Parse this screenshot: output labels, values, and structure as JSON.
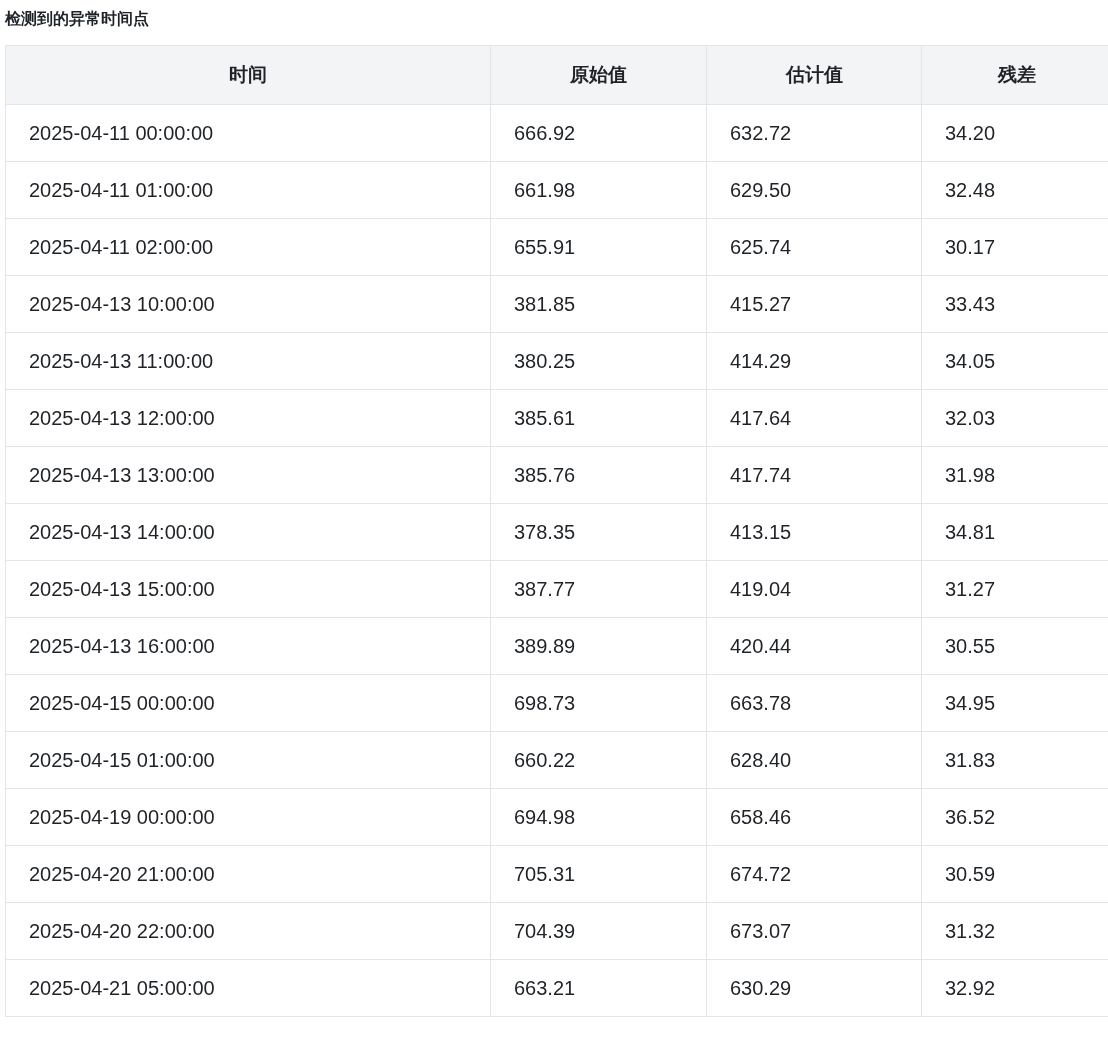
{
  "title": "检测到的异常时间点",
  "table": {
    "columns": [
      "时间",
      "原始值",
      "估计值",
      "残差"
    ],
    "rows": [
      [
        "2025-04-11 00:00:00",
        "666.92",
        "632.72",
        "34.20"
      ],
      [
        "2025-04-11 01:00:00",
        "661.98",
        "629.50",
        "32.48"
      ],
      [
        "2025-04-11 02:00:00",
        "655.91",
        "625.74",
        "30.17"
      ],
      [
        "2025-04-13 10:00:00",
        "381.85",
        "415.27",
        "33.43"
      ],
      [
        "2025-04-13 11:00:00",
        "380.25",
        "414.29",
        "34.05"
      ],
      [
        "2025-04-13 12:00:00",
        "385.61",
        "417.64",
        "32.03"
      ],
      [
        "2025-04-13 13:00:00",
        "385.76",
        "417.74",
        "31.98"
      ],
      [
        "2025-04-13 14:00:00",
        "378.35",
        "413.15",
        "34.81"
      ],
      [
        "2025-04-13 15:00:00",
        "387.77",
        "419.04",
        "31.27"
      ],
      [
        "2025-04-13 16:00:00",
        "389.89",
        "420.44",
        "30.55"
      ],
      [
        "2025-04-15 00:00:00",
        "698.73",
        "663.78",
        "34.95"
      ],
      [
        "2025-04-15 01:00:00",
        "660.22",
        "628.40",
        "31.83"
      ],
      [
        "2025-04-19 00:00:00",
        "694.98",
        "658.46",
        "36.52"
      ],
      [
        "2025-04-20 21:00:00",
        "705.31",
        "674.72",
        "30.59"
      ],
      [
        "2025-04-20 22:00:00",
        "704.39",
        "673.07",
        "31.32"
      ],
      [
        "2025-04-21 05:00:00",
        "663.21",
        "630.29",
        "32.92"
      ]
    ]
  }
}
